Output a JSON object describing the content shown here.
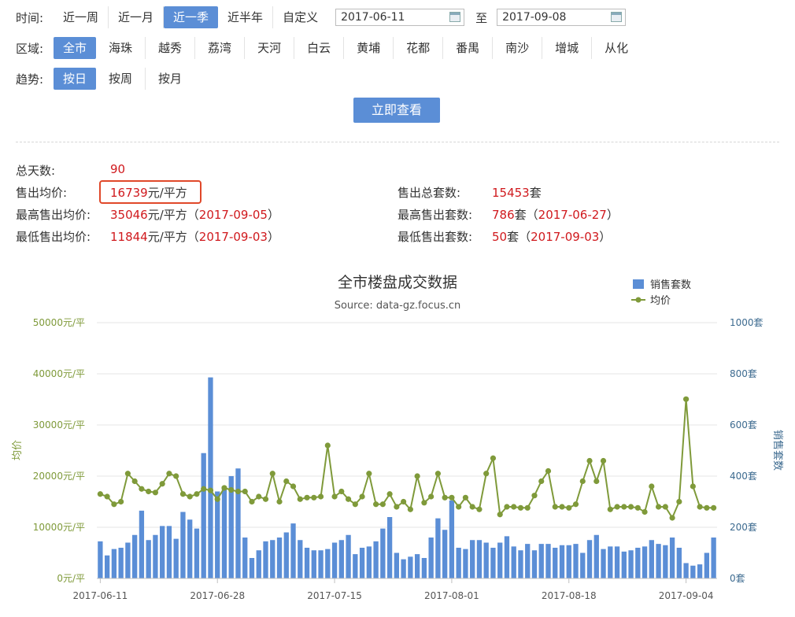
{
  "filters": {
    "time_label": "时间:",
    "time_options": [
      "近一周",
      "近一月",
      "近一季",
      "近半年",
      "自定义"
    ],
    "time_active": 2,
    "start_date": "2017-06-11",
    "to_label": "至",
    "end_date": "2017-09-08",
    "region_label": "区域:",
    "region_options": [
      "全市",
      "海珠",
      "越秀",
      "荔湾",
      "天河",
      "白云",
      "黄埔",
      "花都",
      "番禺",
      "南沙",
      "增城",
      "从化"
    ],
    "region_active": 0,
    "trend_label": "趋势:",
    "trend_options": [
      "按日",
      "按周",
      "按月"
    ],
    "trend_active": 0,
    "query_button": "立即查看"
  },
  "stats": {
    "total_days_label": "总天数:",
    "total_days": "90",
    "avg_price_label": "售出均价:",
    "avg_price": "16739",
    "avg_price_unit": "元/平方",
    "max_price_label": "最高售出均价:",
    "max_price": "35046",
    "max_price_unit": "元/平方（",
    "max_price_date": "2017-09-05",
    "close_paren": "）",
    "min_price_label": "最低售出均价:",
    "min_price": "11844",
    "min_price_unit": "元/平方（",
    "min_price_date": "2017-09-03",
    "total_units_label": "售出总套数:",
    "total_units": "15453",
    "total_units_unit": "套",
    "max_units_label": "最高售出套数:",
    "max_units": "786",
    "max_units_unit": "套（",
    "max_units_date": "2017-06-27",
    "min_units_label": "最低售出套数:",
    "min_units": "50",
    "min_units_unit": "套（",
    "min_units_date": "2017-09-03"
  },
  "colors": {
    "accent": "#5b8ed6",
    "bar": "#5b8ed6",
    "line": "#7f9a3a",
    "red_text": "#d0191d",
    "highlight_box": "#e0482a"
  },
  "chart_data": {
    "type": "bar+line",
    "title": "全市楼盘成交数据",
    "subtitle": "Source: data-gz.focus.cn",
    "y_left_label": "均价",
    "y_right_label": "销售套数",
    "y_left_ticks": [
      "0元/平",
      "10000元/平",
      "20000元/平",
      "30000元/平",
      "40000元/平",
      "50000元/平"
    ],
    "y_right_ticks": [
      "0套",
      "200套",
      "400套",
      "600套",
      "800套",
      "1000套"
    ],
    "y_left_range": [
      0,
      50000
    ],
    "y_right_range": [
      0,
      1000
    ],
    "x_tick_labels": [
      "2017-06-11",
      "2017-06-28",
      "2017-07-15",
      "2017-08-01",
      "2017-08-18",
      "2017-09-04"
    ],
    "x_tick_indices": [
      0,
      17,
      34,
      51,
      68,
      85
    ],
    "legend": [
      {
        "name": "销售套数",
        "icon": "square"
      },
      {
        "name": "均价",
        "icon": "line-dot"
      }
    ],
    "series": [
      {
        "name": "销售套数",
        "type": "bar",
        "axis": "right",
        "values": [
          145,
          90,
          115,
          120,
          140,
          170,
          265,
          150,
          170,
          205,
          205,
          155,
          260,
          230,
          195,
          490,
          786,
          340,
          360,
          400,
          430,
          160,
          80,
          110,
          145,
          150,
          160,
          180,
          215,
          150,
          120,
          110,
          110,
          115,
          140,
          150,
          170,
          95,
          120,
          125,
          145,
          195,
          240,
          100,
          75,
          85,
          95,
          80,
          160,
          235,
          190,
          305,
          120,
          115,
          150,
          150,
          140,
          120,
          140,
          165,
          125,
          110,
          135,
          110,
          135,
          135,
          120,
          130,
          130,
          135,
          100,
          150,
          170,
          115,
          125,
          125,
          105,
          110,
          120,
          125,
          150,
          135,
          130,
          160,
          120,
          60,
          50,
          55,
          100,
          160
        ]
      },
      {
        "name": "均价",
        "type": "line",
        "axis": "left",
        "values": [
          16500,
          16000,
          14500,
          15000,
          20500,
          19000,
          17500,
          17000,
          16800,
          18500,
          20500,
          20000,
          16500,
          16000,
          16500,
          17500,
          17200,
          15500,
          17700,
          17300,
          17000,
          17000,
          15000,
          16000,
          15500,
          20500,
          15000,
          19000,
          18000,
          15500,
          15800,
          15800,
          16000,
          26000,
          16000,
          17000,
          15500,
          14500,
          16000,
          20500,
          14500,
          14500,
          16500,
          14000,
          15000,
          13500,
          20000,
          14800,
          16000,
          20500,
          15800,
          15800,
          14000,
          15800,
          14000,
          13500,
          20500,
          23500,
          12500,
          14000,
          14000,
          13800,
          13800,
          16200,
          19000,
          21000,
          14000,
          14000,
          13800,
          14500,
          19000,
          23000,
          19000,
          23000,
          13500,
          14000,
          14000,
          14000,
          13800,
          13000,
          18000,
          14000,
          14000,
          11844,
          15000,
          35046,
          18000,
          14000,
          13800,
          13800
        ]
      }
    ]
  }
}
